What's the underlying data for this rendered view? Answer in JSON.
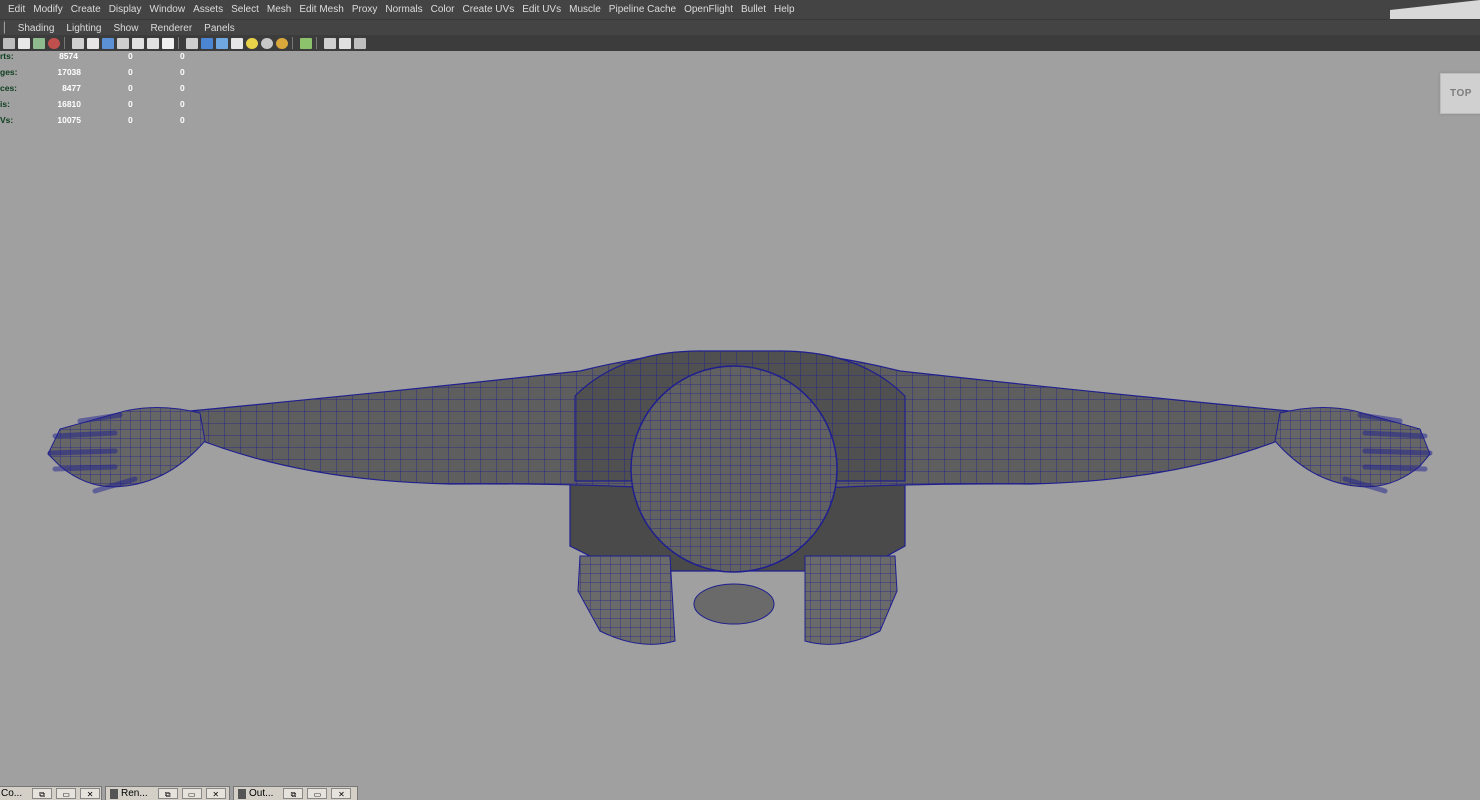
{
  "menu": [
    "Edit",
    "Modify",
    "Create",
    "Display",
    "Window",
    "Assets",
    "Select",
    "Mesh",
    "Edit Mesh",
    "Proxy",
    "Normals",
    "Color",
    "Create UVs",
    "Edit UVs",
    "Muscle",
    "Pipeline Cache",
    "OpenFlight",
    "Bullet",
    "Help"
  ],
  "panel_menu": [
    "Shading",
    "Lighting",
    "Show",
    "Renderer",
    "Panels"
  ],
  "toolbar_icons": [
    "camera-attributes-icon",
    "bookmark-icon",
    "image-plane-icon",
    "grid-icon",
    "film-gate-icon",
    "resolution-gate-icon",
    "wireframe-icon",
    "smooth-shade-icon",
    "shaded-wire-icon",
    "textured-icon",
    "lighting-icon",
    "isolate-icon",
    "xray-icon",
    "default-light-icon",
    "all-lights-icon",
    "shadows-icon",
    "select-icon",
    "panel-layout-icon",
    "viewcube-icon",
    "camera-icon"
  ],
  "hud": [
    {
      "label": "rts:",
      "v1": "8574",
      "v2": "0",
      "v3": "0"
    },
    {
      "label": "ges:",
      "v1": "17038",
      "v2": "0",
      "v3": "0"
    },
    {
      "label": "ces:",
      "v1": "8477",
      "v2": "0",
      "v3": "0"
    },
    {
      "label": "is:",
      "v1": "16810",
      "v2": "0",
      "v3": "0"
    },
    {
      "label": "Vs:",
      "v1": "10075",
      "v2": "0",
      "v3": "0"
    }
  ],
  "view_cube_label": "TOP",
  "camera_label": "top",
  "taskbar": [
    {
      "label": "Co..."
    },
    {
      "label": "Ren..."
    },
    {
      "label": "Out..."
    }
  ],
  "colors": {
    "viewport_bg": "#a0a0a0",
    "menubar_bg": "#444444",
    "wire": "#1f1f8f",
    "mesh_fill": "#5c5c5c",
    "hud_label": "#0b3c1d"
  }
}
